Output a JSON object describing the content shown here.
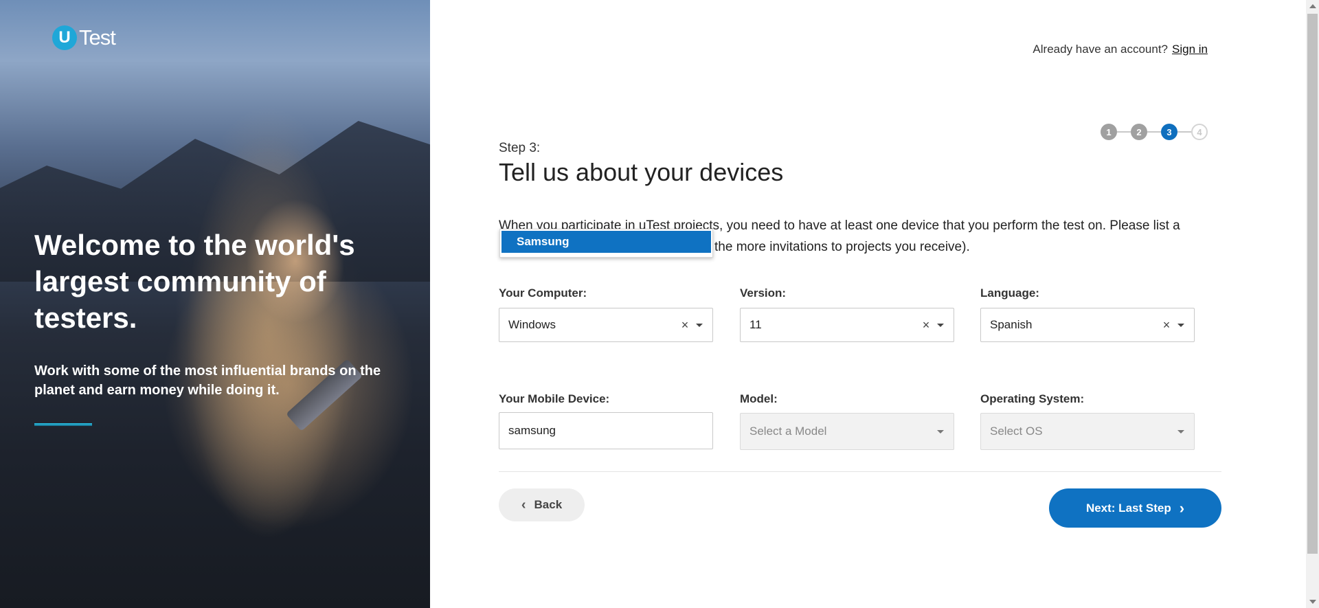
{
  "brand": {
    "badge_letter": "U",
    "name": "Test",
    "color": "#1fa7d8"
  },
  "hero": {
    "title": "Welcome to the world's largest community of testers.",
    "subtitle": "Work with some of the most influential brands on the planet and earn money while doing it."
  },
  "header": {
    "account_prompt": "Already have an account?",
    "sign_in_link": "Sign in"
  },
  "stepper": {
    "steps": [
      "1",
      "2",
      "3",
      "4"
    ],
    "current": 3
  },
  "form": {
    "step_label": "Step 3:",
    "title": "Tell us about your devices",
    "intro_visible": "When you participate in uTest projects, you need to have at least one device that you perform the test on. Please list a",
    "intro_line2_visible": "the more invitations to projects you receive).",
    "computer": {
      "label": "Your Computer:",
      "value": "Windows"
    },
    "version": {
      "label": "Version:",
      "value": "11"
    },
    "language": {
      "label": "Language:",
      "value": "Spanish"
    },
    "mobile": {
      "label": "Your Mobile Device:",
      "value": "samsung"
    },
    "model": {
      "label": "Model:",
      "placeholder": "Select a Model"
    },
    "os": {
      "label": "Operating System:",
      "placeholder": "Select OS"
    },
    "autocomplete": {
      "options": [
        "Samsung"
      ]
    }
  },
  "buttons": {
    "back": "Back",
    "next": "Next: Last Step"
  },
  "colors": {
    "primary": "#0f72c2",
    "step_done": "#a0a0a0",
    "step_todo": "#d4d4d4"
  },
  "icons": {
    "clear": "×",
    "chevron_left": "‹",
    "chevron_right": "›"
  }
}
